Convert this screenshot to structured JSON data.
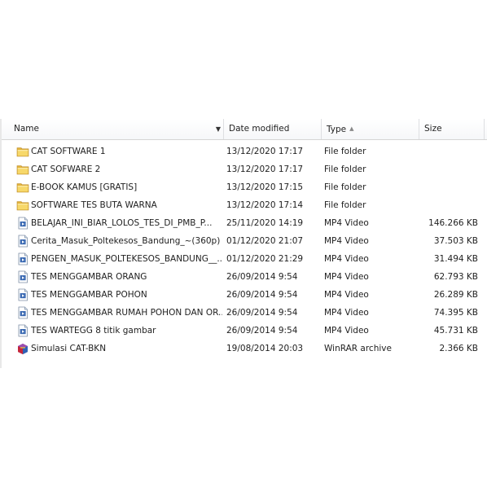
{
  "columns": {
    "name": "Name",
    "date": "Date modified",
    "type": "Type",
    "size": "Size"
  },
  "files": [
    {
      "name": "CAT SOFTWARE 1",
      "date": "13/12/2020 17:17",
      "type": "File folder",
      "size": "",
      "icon": "folder-icon"
    },
    {
      "name": "CAT SOFWARE 2",
      "date": "13/12/2020 17:17",
      "type": "File folder",
      "size": "",
      "icon": "folder-icon"
    },
    {
      "name": "E-BOOK KAMUS [GRATIS]",
      "date": "13/12/2020 17:15",
      "type": "File folder",
      "size": "",
      "icon": "folder-icon"
    },
    {
      "name": "SOFTWARE TES BUTA WARNA",
      "date": "13/12/2020 17:14",
      "type": "File folder",
      "size": "",
      "icon": "folder-icon"
    },
    {
      "name": "BELAJAR_INI_BIAR_LOLOS_TES_DI_PMB_P...",
      "date": "25/11/2020 14:19",
      "type": "MP4 Video",
      "size": "146.266 KB",
      "icon": "video-file-icon"
    },
    {
      "name": "Cerita_Masuk_Poltekesos_Bandung_~(360p)",
      "date": "01/12/2020 21:07",
      "type": "MP4 Video",
      "size": "37.503 KB",
      "icon": "video-file-icon"
    },
    {
      "name": "PENGEN_MASUK_POLTEKESOS_BANDUNG__...",
      "date": "01/12/2020 21:29",
      "type": "MP4 Video",
      "size": "31.494 KB",
      "icon": "video-file-icon"
    },
    {
      "name": "TES MENGGAMBAR ORANG",
      "date": "26/09/2014 9:54",
      "type": "MP4 Video",
      "size": "62.793 KB",
      "icon": "video-file-icon"
    },
    {
      "name": "TES MENGGAMBAR POHON",
      "date": "26/09/2014 9:54",
      "type": "MP4 Video",
      "size": "26.289 KB",
      "icon": "video-file-icon"
    },
    {
      "name": "TES MENGGAMBAR RUMAH POHON DAN OR...",
      "date": "26/09/2014 9:54",
      "type": "MP4 Video",
      "size": "74.395 KB",
      "icon": "video-file-icon"
    },
    {
      "name": "TES WARTEGG 8 titik gambar",
      "date": "26/09/2014 9:54",
      "type": "MP4 Video",
      "size": "45.731 KB",
      "icon": "video-file-icon"
    },
    {
      "name": "Simulasi CAT-BKN",
      "date": "19/08/2014 20:03",
      "type": "WinRAR archive",
      "size": "2.366 KB",
      "icon": "winrar-archive-icon"
    }
  ]
}
